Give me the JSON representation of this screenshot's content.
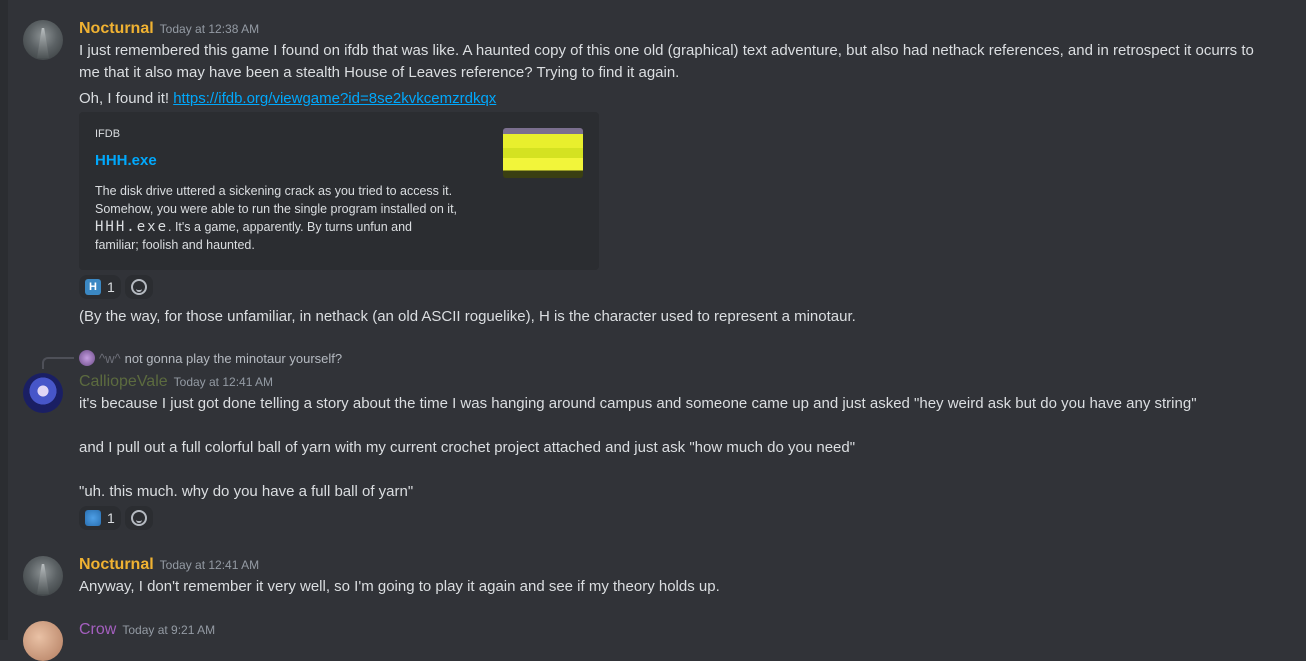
{
  "messages": [
    {
      "author": "Nocturnal",
      "timestamp": "Today at 12:38 AM",
      "lines": [
        "I just remembered this game I found on ifdb that was like. A haunted copy of this one old (graphical) text adventure, but also had nethack references, and in retrospect it ocurrs to",
        "me that it also may have been a stealth House of Leaves reference? Trying to find it again."
      ],
      "followup_prefix": "Oh, I found it! ",
      "followup_link": "https://ifdb.org/viewgame?id=8se2kvkcemzrdkqx",
      "embed": {
        "provider": "IFDB",
        "title": "HHH.exe",
        "desc_line1": "The disk drive uttered a sickening crack as you tried to access it.",
        "desc_line2": "Somehow, you were able to run the single program installed on it,",
        "desc_mono": "HHH.exe",
        "desc_line3": ". It's a game, apparently. By turns unfun and",
        "desc_line4": "familiar; foolish and haunted."
      },
      "reaction": {
        "emoji": "H",
        "count": "1"
      },
      "after_text": "(By the way, for those unfamiliar, in nethack (an old ASCII roguelike), H is the character used to represent a minotaur."
    },
    {
      "reply_to": {
        "author": "^w^",
        "text": "not gonna play the minotaur yourself?"
      },
      "author": "CalliopeVale",
      "timestamp": "Today at 12:41 AM",
      "p1": "it's because I just got done telling a story about the time I was hanging around campus and someone came up and just asked \"hey weird ask but do you have any string\"",
      "p2": "and I pull out a full colorful ball of yarn with my current crochet project attached and just ask \"how much do you need\"",
      "p3": "\"uh. this much. why do you have a full ball of yarn\"",
      "reaction": {
        "emoji": "yarn",
        "count": "1"
      }
    },
    {
      "author": "Nocturnal",
      "timestamp": "Today at 12:41 AM",
      "text": "Anyway, I don't remember it very well, so I'm going to play it again and see if my theory holds up."
    },
    {
      "author": "Crow",
      "timestamp": "Today at 9:21 AM"
    }
  ],
  "colors": {
    "background": "#313338",
    "nocturnal": "#f0b232",
    "link": "#00a8fc",
    "crow": "#a45fbf"
  }
}
